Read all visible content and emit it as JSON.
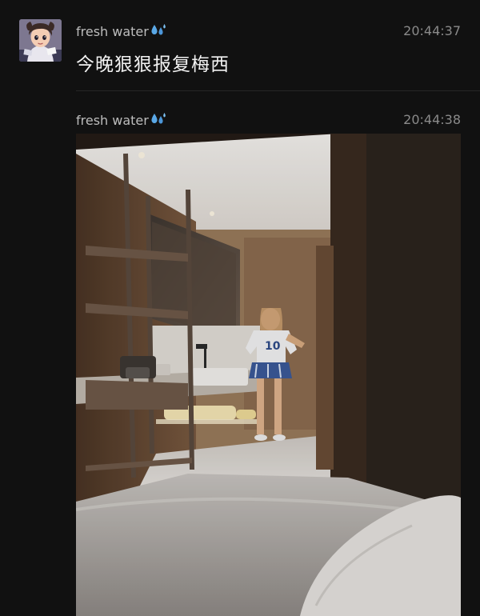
{
  "messages": [
    {
      "sender": "fresh water",
      "sender_emoji": "water-drops-icon",
      "time": "20:44:37",
      "text": "今晚狠狠报复梅西"
    },
    {
      "sender": "fresh water",
      "sender_emoji": "water-drops-icon",
      "time": "20:44:38",
      "image": "hotel-room-photo"
    }
  ],
  "colors": {
    "background": "#111111",
    "sender_name": "#bdbdbd",
    "timestamp": "#8a8a8a",
    "message_text": "#f2f2f2",
    "emoji_blue": "#5aa8e6"
  }
}
